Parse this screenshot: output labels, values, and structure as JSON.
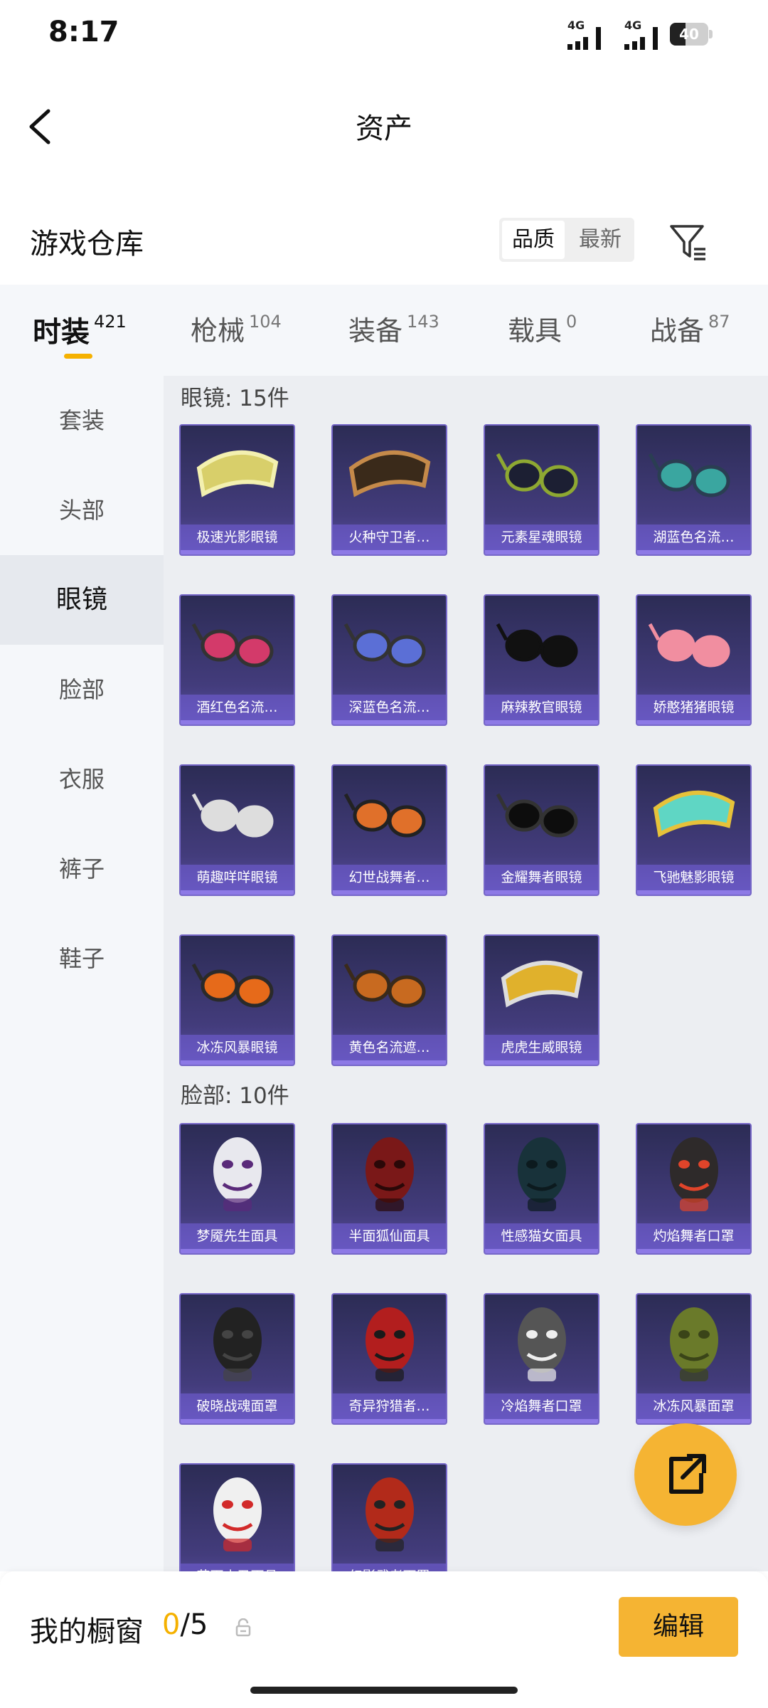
{
  "status": {
    "time": "8:17",
    "signal1_label": "4G",
    "signal2_label": "4G",
    "battery": "40",
    "battery_level": 0.4
  },
  "header": {
    "title": "资产",
    "back_icon": "back-arrow-icon"
  },
  "warehouse": {
    "title": "游戏仓库",
    "sort_options": [
      "品质",
      "最新"
    ],
    "sort_selected": "品质",
    "filter_icon": "filter-icon"
  },
  "tabs": [
    {
      "name": "时装",
      "count": "421",
      "active": true
    },
    {
      "name": "枪械",
      "count": "104",
      "active": false
    },
    {
      "name": "装备",
      "count": "143",
      "active": false
    },
    {
      "name": "载具",
      "count": "0",
      "active": false
    },
    {
      "name": "战备",
      "count": "87",
      "active": false
    }
  ],
  "sidebar": [
    {
      "label": "套装",
      "active": false
    },
    {
      "label": "头部",
      "active": false
    },
    {
      "label": "眼镜",
      "active": true
    },
    {
      "label": "脸部",
      "active": false
    },
    {
      "label": "衣服",
      "active": false
    },
    {
      "label": "裤子",
      "active": false
    },
    {
      "label": "鞋子",
      "active": false
    }
  ],
  "sections": [
    {
      "title": "眼镜: 15件",
      "items": [
        {
          "name": "极速光影眼镜",
          "art": "goggles-yellow"
        },
        {
          "name": "火种守卫者…",
          "art": "visor-orange"
        },
        {
          "name": "元素星魂眼镜",
          "art": "glasses-green"
        },
        {
          "name": "湖蓝色名流…",
          "art": "glasses-teal"
        },
        {
          "name": "酒红色名流…",
          "art": "glasses-red"
        },
        {
          "name": "深蓝色名流…",
          "art": "glasses-blue"
        },
        {
          "name": "麻辣教官眼镜",
          "art": "glasses-black-rect"
        },
        {
          "name": "娇憨猪猪眼镜",
          "art": "glasses-pink"
        },
        {
          "name": "萌趣咩咩眼镜",
          "art": "glasses-white-round"
        },
        {
          "name": "幻世战舞者…",
          "art": "sunglasses-orange"
        },
        {
          "name": "金耀舞者眼镜",
          "art": "sunglasses-black"
        },
        {
          "name": "飞驰魅影眼镜",
          "art": "visor-teal"
        },
        {
          "name": "冰冻风暴眼镜",
          "art": "glasses-orange"
        },
        {
          "name": "黄色名流遮…",
          "art": "glasses-amber"
        },
        {
          "name": "虎虎生威眼镜",
          "art": "goggles-gold"
        }
      ]
    },
    {
      "title": "脸部: 10件",
      "items": [
        {
          "name": "梦魇先生面具",
          "art": "mask-clown-purple"
        },
        {
          "name": "半面狐仙面具",
          "art": "mask-fox-red"
        },
        {
          "name": "性感猫女面具",
          "art": "mask-cat-teal"
        },
        {
          "name": "灼焰舞者口罩",
          "art": "mask-flame-red"
        },
        {
          "name": "破晓战魂面罩",
          "art": "mask-wolf-black"
        },
        {
          "name": "奇异狩猎者…",
          "art": "mask-hunter-red"
        },
        {
          "name": "冷焰舞者口罩",
          "art": "mask-flame-white"
        },
        {
          "name": "冰冻风暴面罩",
          "art": "mask-camo-green"
        },
        {
          "name": "花面小丑面具",
          "art": "mask-clown-white"
        },
        {
          "name": "幻影武者面罩",
          "art": "mask-gas-red"
        }
      ]
    }
  ],
  "footer": {
    "label": "我的橱窗",
    "current": "0",
    "slash": "/",
    "max": "5",
    "lock_icon": "lock-icon",
    "edit_label": "编辑"
  },
  "fab_icon": "share-external-icon",
  "colors": {
    "accent": "#f5b100",
    "button": "#f5b433",
    "card_border": "#7667c8"
  }
}
